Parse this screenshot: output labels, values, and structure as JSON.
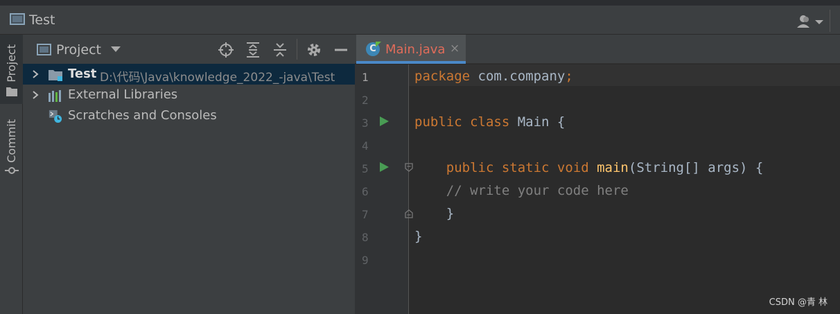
{
  "window": {
    "title": "Test"
  },
  "left_strip": {
    "project_label": "Project",
    "commit_label": "Commit"
  },
  "project_panel": {
    "title": "Project",
    "tree": [
      {
        "name": "Test",
        "path": "D:\\代码\\Java\\knowledge_2022_-java\\Test"
      },
      {
        "name": "External Libraries"
      },
      {
        "name": "Scratches and Consoles"
      }
    ]
  },
  "editor": {
    "tab": {
      "filename": "Main.java",
      "close_glyph": "×",
      "icon_letter": "C"
    },
    "line_numbers": [
      "1",
      "2",
      "3",
      "4",
      "5",
      "6",
      "7",
      "8",
      "9"
    ],
    "lines": {
      "l1": {
        "kw": "package",
        "rest": " com.company",
        "semi": ";"
      },
      "l3": {
        "kw": "public class",
        "rest": " Main {"
      },
      "l5": {
        "kw": "public static void",
        "fn": " main",
        "rest": "(String[] args) {"
      },
      "l6": {
        "comment": "// write your code here"
      },
      "l7": {
        "text": "}"
      },
      "l8": {
        "text": "}"
      }
    }
  },
  "watermark": "CSDN @青  林",
  "colors": {
    "keyword": "#cc7832",
    "function": "#ffc66d",
    "comment": "#808080",
    "tab_accent": "#4a88c7",
    "tab_filename": "#e06c5a",
    "run": "#499c54"
  }
}
